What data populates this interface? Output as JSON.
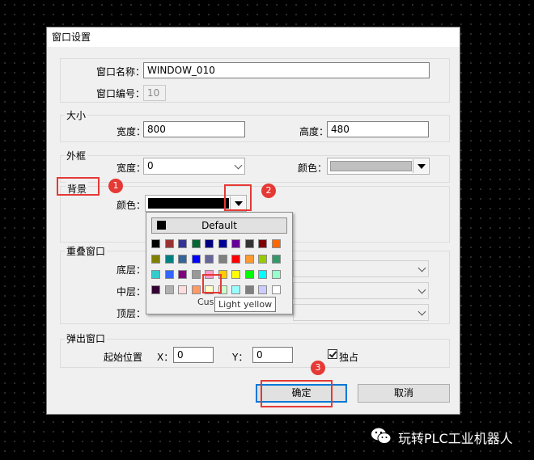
{
  "dialog": {
    "title": "窗口设置"
  },
  "name_section": {
    "name_label": "窗口名称：",
    "name_value": "WINDOW_010",
    "number_label": "窗口编号：",
    "number_value": "10"
  },
  "size": {
    "title": "大小",
    "width_label": "宽度：",
    "width_value": "800",
    "height_label": "高度：",
    "height_value": "480"
  },
  "frame": {
    "title": "外框",
    "width_label": "宽度：",
    "width_value": "0",
    "color_label": "颜色：",
    "color": "#c0c0c0"
  },
  "background": {
    "title": "背景",
    "color_label": "颜色：",
    "color": "#000000"
  },
  "overlay": {
    "title": "重叠窗口",
    "bottom_label": "底层：",
    "middle_label": "中层：",
    "top_label": "顶层："
  },
  "popup_window": {
    "title": "弹出窗口",
    "start_label": "起始位置",
    "x_label": "X：",
    "x_value": "0",
    "y_label": "Y：",
    "y_value": "0",
    "exclusive_label": "独占",
    "exclusive_checked": true
  },
  "buttons": {
    "ok": "确定",
    "cancel": "取消"
  },
  "color_picker": {
    "default_label": "Default",
    "custom_label": "Cus",
    "tooltip": "Light yellow",
    "palette": [
      [
        "#000000",
        "#993333",
        "#333399",
        "#006633",
        "#000080",
        "#000099",
        "#660099",
        "#333333",
        "#800000",
        "#ff6600"
      ],
      [
        "#808000",
        "#008080",
        "#336699",
        "#0000ff",
        "#666699",
        "#808080",
        "#ff0000",
        "#ff9933",
        "#99cc00",
        "#339966"
      ],
      [
        "#33cccc",
        "#3366ff",
        "#800080",
        "#999999",
        "#ff99cc",
        "#ffcc00",
        "#ffff00",
        "#00ff00",
        "#00ffff",
        "#99ffcc"
      ],
      [
        "#330033",
        "#b0b0b0",
        "#ffdddd",
        "#ff9966",
        "#ffffcc",
        "#ccffcc",
        "#99ffff",
        "#808080",
        "#ccccff",
        "#ffffff"
      ]
    ],
    "selected": "Light yellow"
  },
  "annotations": [
    "1",
    "2",
    "3"
  ],
  "watermark": {
    "text": "玩转PLC工业机器人"
  }
}
